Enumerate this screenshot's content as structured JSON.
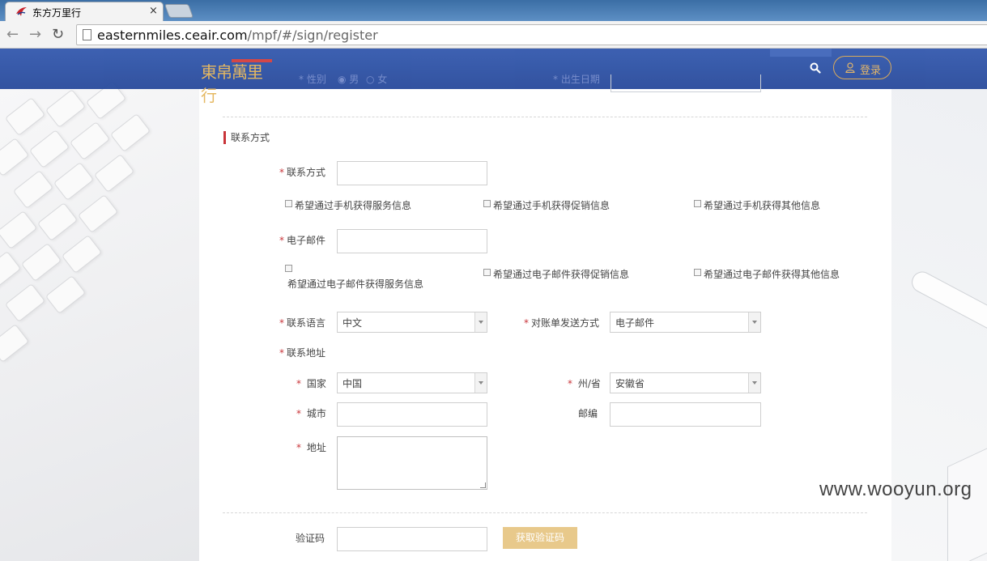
{
  "browser": {
    "tab_title": "东方万里行",
    "tab_close": "×",
    "url_host": "easternmiles.ceair.com",
    "url_path": "/mpf/#/sign/register"
  },
  "header": {
    "logo_text": "東帛萬里行",
    "login_label": "登录",
    "ghost_gender_label": "* 性别",
    "ghost_gender_male": "男",
    "ghost_gender_female": "女",
    "ghost_birth_label": "* 出生日期"
  },
  "section": {
    "title": "联系方式"
  },
  "form": {
    "required_mark": "*",
    "contact_label": "联系方式",
    "contact_value": "",
    "sms_service": "希望通过手机获得服务信息",
    "sms_promo": "希望通过手机获得促销信息",
    "sms_other": "希望通过手机获得其他信息",
    "email_label": "电子邮件",
    "email_value": "",
    "email_service": "希望通过电子邮件获得服务信息",
    "email_promo": "希望通过电子邮件获得促销信息",
    "email_other": "希望通过电子邮件获得其他信息",
    "language_label": "联系语言",
    "language_value": "中文",
    "statement_label": "对账单发送方式",
    "statement_value": "电子邮件",
    "address_group_label": "联系地址",
    "country_label": "国家",
    "country_value": "中国",
    "province_label": "州/省",
    "province_value": "安徽省",
    "city_label": "城市",
    "city_value": "",
    "zip_label": "邮编",
    "zip_value": "",
    "address_label": "地址",
    "address_value": "",
    "captcha_label": "验证码",
    "captcha_value": "",
    "captcha_button": "获取验证码"
  },
  "watermark": "www.wooyun.org",
  "colors": {
    "header_blue": "#2a4fa3",
    "gold": "#e2b160",
    "accent_red": "#c9353a",
    "captcha_button": "#e8c98b"
  }
}
